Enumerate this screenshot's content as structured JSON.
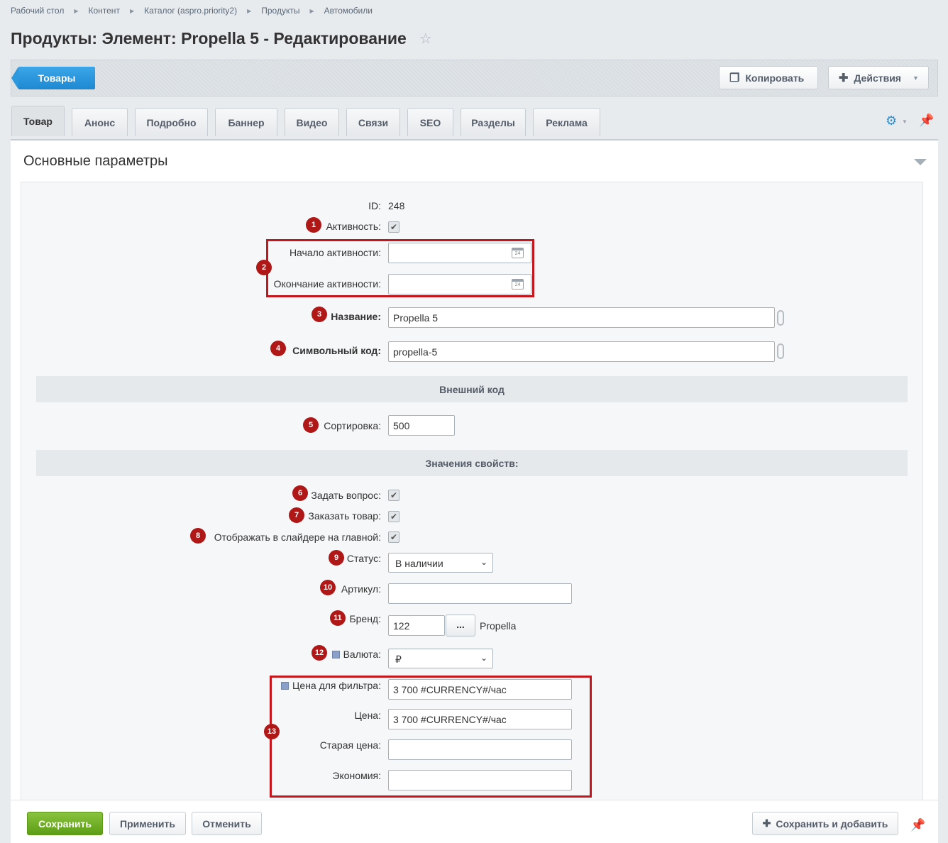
{
  "breadcrumbs": [
    "Рабочий стол",
    "Контент",
    "Каталог (aspro.priority2)",
    "Продукты",
    "Автомобили"
  ],
  "page_title": "Продукты: Элемент: Propella 5 - Редактирование",
  "toolbar": {
    "back_label": "Товары",
    "copy_label": "Копировать",
    "actions_label": "Действия"
  },
  "tabs": [
    "Товар",
    "Анонс",
    "Подробно",
    "Баннер",
    "Видео",
    "Связи",
    "SEO",
    "Разделы",
    "Реклама"
  ],
  "section_title": "Основные параметры",
  "fields": {
    "id_label": "ID:",
    "id_value": "248",
    "active_label": "Активность:",
    "active_start_label": "Начало активности:",
    "active_end_label": "Окончание активности:",
    "name_label": "Название:",
    "name_value": "Propella 5",
    "code_label": "Символьный код:",
    "code_value": "propella-5",
    "external_code_header": "Внешний код",
    "sort_label": "Сортировка:",
    "sort_value": "500",
    "properties_header": "Значения свойств:",
    "ask_label": "Задать вопрос:",
    "order_label": "Заказать товар:",
    "slider_label": "Отображать в слайдере на главной:",
    "status_label": "Статус:",
    "status_value": "В наличии",
    "article_label": "Артикул:",
    "brand_label": "Бренд:",
    "brand_id": "122",
    "brand_button": "...",
    "brand_name": "Propella",
    "currency_label": "Валюта:",
    "currency_value": "₽",
    "filter_price_label": "Цена для фильтра:",
    "filter_price_value": "3 700 #CURRENCY#/час",
    "price_label": "Цена:",
    "price_value": "3 700 #CURRENCY#/час",
    "old_price_label": "Старая цена:",
    "economy_label": "Экономия:"
  },
  "markers": [
    "1",
    "2",
    "3",
    "4",
    "5",
    "6",
    "7",
    "8",
    "9",
    "10",
    "11",
    "12",
    "13"
  ],
  "calendar_day": "24",
  "bottom": {
    "save": "Сохранить",
    "apply": "Применить",
    "cancel": "Отменить",
    "save_add": "Сохранить и добавить"
  },
  "colors": {
    "accent_blue": "#1e88d2",
    "save_green": "#6aa820",
    "marker_red": "#b01717"
  }
}
